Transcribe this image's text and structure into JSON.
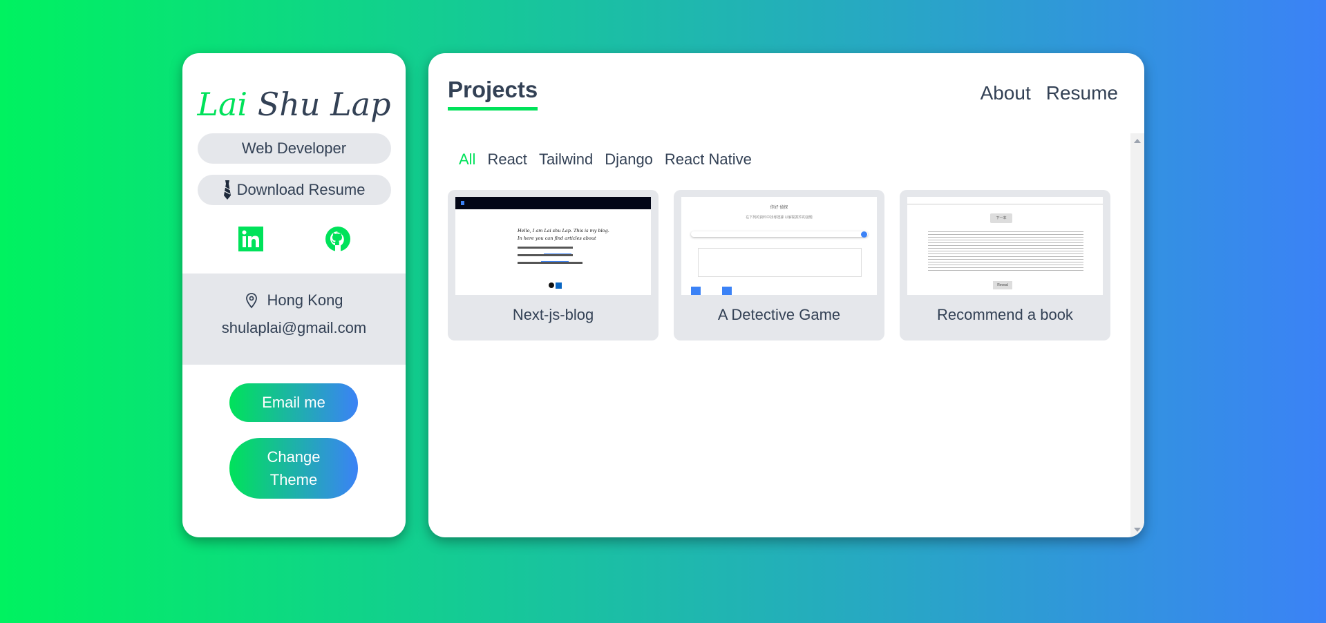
{
  "profile": {
    "first_name": "Lai",
    "last_name": "Shu Lap",
    "role": "Web Developer",
    "download_label": "Download Resume",
    "location": "Hong Kong",
    "email": "shulaplai@gmail.com",
    "email_button": "Email me",
    "theme_button": "Change Theme",
    "social_icons": [
      "linkedin-icon",
      "github-icon"
    ]
  },
  "header": {
    "active_tab": "Projects",
    "nav": [
      "About",
      "Resume"
    ]
  },
  "filters": [
    "All",
    "React",
    "Tailwind",
    "Django",
    "React Native"
  ],
  "projects": [
    {
      "title": "Next-js-blog",
      "preview_text": "Hello, I am Lai shu Lap. This is my blog. In here you can find articles about"
    },
    {
      "title": "A Detective Game",
      "preview_heading": "你好 偵探",
      "preview_sub": "在下列的資料中找尋證據 以解開案件的謎題"
    },
    {
      "title": "Recommend a book",
      "preview_button": "下一本",
      "preview_reveal": "Reveal"
    }
  ],
  "colors": {
    "accent": "#00e25a",
    "gradient_end": "#3b82f6",
    "pill_bg": "#e5e7eb",
    "text": "#334155"
  }
}
